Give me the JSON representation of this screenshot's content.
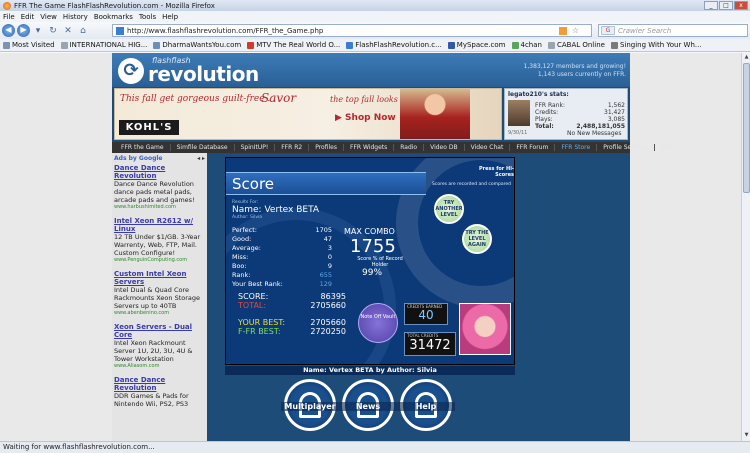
{
  "window": {
    "title": "FFR The Game FlashFlashRevolution.com - Mozilla Firefox",
    "controls": [
      "_",
      "□",
      "x"
    ]
  },
  "menu": [
    "File",
    "Edit",
    "View",
    "History",
    "Bookmarks",
    "Tools",
    "Help"
  ],
  "nav": {
    "url": "http://www.flashflashrevolution.com/FFR_the_Game.php",
    "search_placeholder": "Crawler Search"
  },
  "bookmarks": [
    "Most Visited",
    "INTERNATIONAL HIG...",
    "DharmaWantsYou.com",
    "MTV The Real World O...",
    "FlashFlashRevolution.c...",
    "MySpace.com",
    "4chan",
    "CABAL Online",
    "Singing With Your Wh..."
  ],
  "site": {
    "logo_small": "flashflash",
    "logo_big": "revolution",
    "members_line": "1,383,127 members and growing!",
    "online_line": "1,143 users currently on FFR."
  },
  "ad_banner": {
    "line1": "This fall get gorgeous guilt-free . . .",
    "line2": "Savor",
    "line3": "the top fall looks",
    "shop": "▶ Shop Now",
    "brand": "KOHL'S"
  },
  "userbox": {
    "name": "legato210's stats:",
    "rows": [
      {
        "k": "FFR Rank:",
        "v": "1,562"
      },
      {
        "k": "Credits:",
        "v": "31,427"
      },
      {
        "k": "Plays:",
        "v": "3,085"
      },
      {
        "k": "Total:",
        "v": "2,488,181,055"
      }
    ],
    "last": "9/30/11",
    "messages": "No New Messages"
  },
  "site_nav": [
    "FFR the Game",
    "Simfile Database",
    "SpinItUP!",
    "FFR R2",
    "Profiles",
    "FFR Widgets",
    "Radio",
    "Video DB",
    "Video Chat",
    "FFR Forum",
    "FFR Store",
    "Profile Settings",
    "FAQ"
  ],
  "left_ads": {
    "ads_by": "Ads by Google",
    "nav_arrows": "◂ ▸",
    "items": [
      {
        "h": "Dance Dance Revolution",
        "d": "Dance Dance Revolution dance pads metal pads, arcade pads and games!",
        "u": "www.harbushimited.com"
      },
      {
        "h": "Intel Xeon R2612 w/ Linux",
        "d": "12 TB Under $1/GB. 3-Year Warrenty, Web, FTP, Mail. Custom Configure!",
        "u": "www.PenguinComputing.com"
      },
      {
        "h": "Custom Intel Xeon Servers",
        "d": "Intel Dual & Quad Core Rackmounts Xeon Storage Servers up to 40TB",
        "u": "www.abenbenino.com"
      },
      {
        "h": "Xeon Servers - Dual Core",
        "d": "Intel Xeon Rackmount Server 1U, 2U, 3U, 4U & Tower Workstation",
        "u": "www.Aliasom.com"
      },
      {
        "h": "Dance Dance Revolution",
        "d": "DDR Games & Pads for Nintendo Wii, PS2, PS3",
        "u": ""
      }
    ]
  },
  "game": {
    "title": "Score",
    "press_hi": "Press for Hi-Scores",
    "hi_sub": "Scores are recorded and compared",
    "try_another": "TRY ANOTHER LEVEL",
    "try_again": "TRY THE LEVEL AGAIN",
    "results_for": "Results For:",
    "song": "Name: Vertex BETA",
    "author": "Author: Silvia",
    "judges": [
      {
        "k": "Perfect:",
        "v": "1705"
      },
      {
        "k": "Good:",
        "v": "47"
      },
      {
        "k": "Average:",
        "v": "3"
      },
      {
        "k": "Miss:",
        "v": "0"
      },
      {
        "k": "Boo:",
        "v": "9"
      },
      {
        "k": "Rank:",
        "v": "655"
      },
      {
        "k": "Your Best Rank:",
        "v": "129"
      }
    ],
    "max_combo_label": "MAX COMBO",
    "max_combo": "1755",
    "pct_label": "Score % of Record Holder",
    "pct": "99%",
    "score_k": "SCORE:",
    "score_v": "86395",
    "total_k": "TOTAL:",
    "total_v": "2705660",
    "yourbest_k": "YOUR BEST:",
    "yourbest_v": "2705660",
    "ffrbest_k": "F-FR BEST:",
    "ffrbest_v": "2720250",
    "vault": "Note Off Vault",
    "credits_label": "CREDITS EARNED",
    "credits": "40",
    "total_credits_label": "TOTAL CREDITS",
    "total_credits": "31472",
    "name_line": "Name: Vertex BETA by Author: Silvia"
  },
  "big_buttons": [
    "Multiplayer",
    "News",
    "Help"
  ],
  "status": "Waiting for www.flashflashrevolution.com..."
}
